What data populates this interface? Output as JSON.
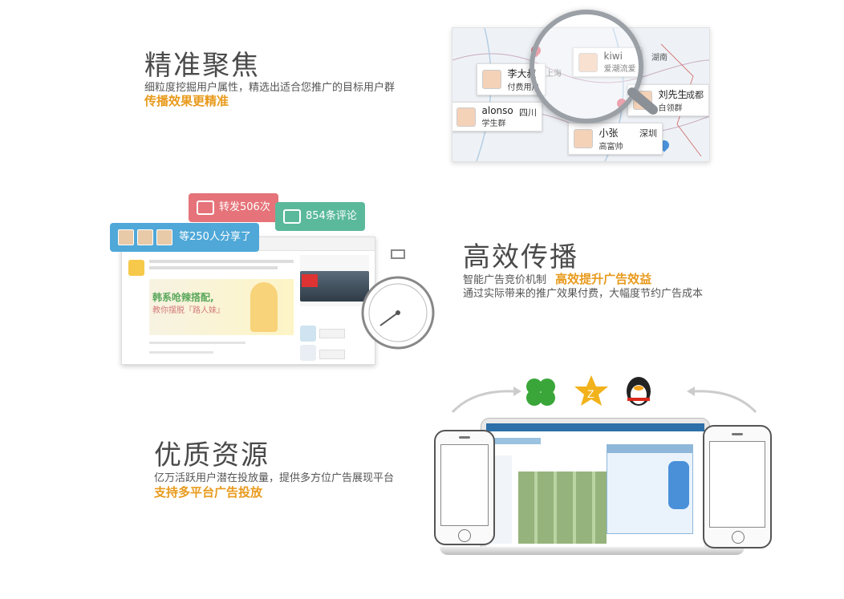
{
  "section1": {
    "title": "精准聚焦",
    "desc": "细粒度挖掘用户属性，精选出适合您推广的目标用户群",
    "highlight": "传播效果更精准",
    "map_cards": [
      {
        "name": "kiwi",
        "sub": "爱潮流爱",
        "place": "湖南"
      },
      {
        "name": "李大叔",
        "sub": "付费用户",
        "place": "上海"
      },
      {
        "name": "刘先生",
        "sub": "白领群",
        "place": "成都"
      },
      {
        "name": "alonso",
        "sub": "学生群",
        "place": "四川"
      },
      {
        "name": "小张",
        "sub": "高富帅",
        "place": "深圳"
      }
    ]
  },
  "section2": {
    "title": "高效传播",
    "desc_prefix": "智能广告竞价机制",
    "highlight": "高效提升广告效益",
    "desc2": "通过实际带来的推广效果付费，大幅度节约广告成本",
    "bubbles": {
      "share": "等250人分享了",
      "forward": "转发506次",
      "comment": "854条评论"
    },
    "post": {
      "headline": "韩系呛辣搭配,",
      "subline": "教你摆脱『路人妹』"
    }
  },
  "section3": {
    "title": "优质资源",
    "desc": "亿万活跃用户潜在投放量，提供多方位广告展现平台",
    "highlight": "支持多平台广告投放"
  },
  "colors": {
    "highlight": "#e89a1c",
    "bubble_blue": "#4fa8d8",
    "bubble_red": "#e57379",
    "bubble_green": "#5ab99a"
  },
  "icons": [
    "clover-icon",
    "qzone-star-icon",
    "qq-penguin-icon",
    "stopwatch-icon",
    "magnifier-icon",
    "map-pin-icon"
  ]
}
